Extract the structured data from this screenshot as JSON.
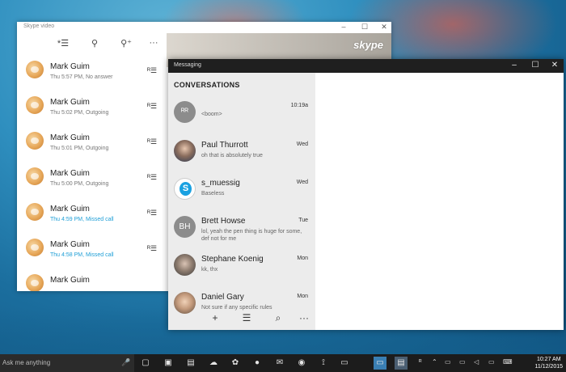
{
  "skype_video": {
    "title": "Skype video",
    "controls": [
      "–",
      "☐",
      "✕"
    ],
    "toolbar": [
      "*☰",
      "⚲",
      "⚲⁺",
      "···"
    ],
    "logo": "skype",
    "calls": [
      {
        "name": "Mark Guim",
        "detail": "Thu 5:57 PM, No answer",
        "missed": false
      },
      {
        "name": "Mark Guim",
        "detail": "Thu 5:02 PM, Outgoing",
        "missed": false
      },
      {
        "name": "Mark Guim",
        "detail": "Thu 5:01 PM, Outgoing",
        "missed": false
      },
      {
        "name": "Mark Guim",
        "detail": "Thu 5:00 PM, Outgoing",
        "missed": false
      },
      {
        "name": "Mark Guim",
        "detail": "Thu 4:59 PM, Missed call",
        "missed": true
      },
      {
        "name": "Mark Guim",
        "detail": "Thu 4:58 PM, Missed call",
        "missed": true
      },
      {
        "name": "Mark Guim",
        "detail": "",
        "missed": false
      }
    ],
    "call_icon": "ᴿ☰"
  },
  "messaging": {
    "title": "Messaging",
    "controls": [
      "–",
      "☐",
      "✕"
    ],
    "header": "CONVERSATIONS",
    "conversations": [
      {
        "name": "",
        "time": "10:19a",
        "preview": "<boom>",
        "avatar": "group",
        "avatar_text": "ᴿᴿ"
      },
      {
        "name": "Paul Thurrott",
        "time": "Wed",
        "preview": "oh that is absolutely true",
        "avatar": "photo1",
        "avatar_text": ""
      },
      {
        "name": "s_muessig",
        "time": "Wed",
        "preview": "Baseless",
        "avatar": "skype",
        "avatar_text": ""
      },
      {
        "name": "Brett Howse",
        "time": "Tue",
        "preview": "lol, yeah the pen thing is huge for some, def not for me",
        "avatar": "initials",
        "avatar_text": "BH"
      },
      {
        "name": "Stephane Koenig",
        "time": "Mon",
        "preview": "kk, thx",
        "avatar": "photo2",
        "avatar_text": ""
      },
      {
        "name": "Daniel Gary",
        "time": "Mon",
        "preview": "Not sure if any specific rules",
        "avatar": "photo3",
        "avatar_text": ""
      }
    ],
    "bottom_actions": [
      "+",
      "☰",
      "⌕",
      "···"
    ]
  },
  "taskbar": {
    "search_placeholder": "Ask me anything",
    "mic": "🎤",
    "apps": [
      "▢",
      "▣",
      "▤",
      "☁",
      "✿",
      "●",
      "✉",
      "◉",
      "⟟",
      "▭",
      "▤"
    ],
    "tray": [
      "ᴿ",
      "⌃",
      "▭",
      "▭",
      "◁",
      "▭",
      "⌨"
    ],
    "time": "10:27 AM",
    "date": "11/12/2015"
  }
}
